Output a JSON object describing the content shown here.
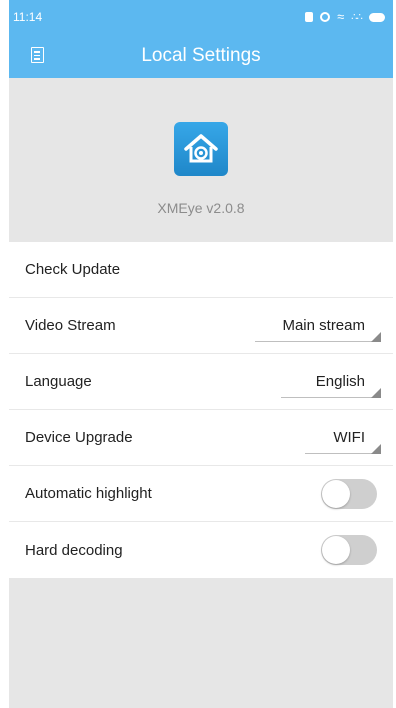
{
  "status_bar": {
    "time": "11:14"
  },
  "header": {
    "title": "Local Settings",
    "menu_icon": "menu-icon"
  },
  "about": {
    "logo_icon": "house-camera-icon",
    "version": "XMEye v2.0.8"
  },
  "settings": {
    "check_update": {
      "label": "Check Update"
    },
    "video_stream": {
      "label": "Video Stream",
      "value": "Main stream"
    },
    "language": {
      "label": "Language",
      "value": "English"
    },
    "device_upgrade": {
      "label": "Device Upgrade",
      "value": "WIFI"
    },
    "automatic_highlight": {
      "label": "Automatic highlight",
      "enabled": false
    },
    "hard_decoding": {
      "label": "Hard decoding",
      "enabled": false
    }
  },
  "colors": {
    "accent": "#5cb8f0",
    "background": "#e6e6e6",
    "toggle_off": "#cfcfcf"
  }
}
